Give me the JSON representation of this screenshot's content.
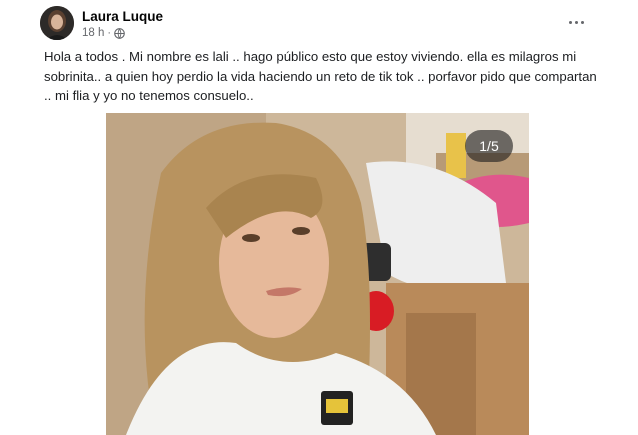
{
  "post": {
    "author": "Laura Luque",
    "time": "18 h",
    "separator": "·",
    "privacy_icon": "globe-icon",
    "more_icon": "more-options-icon",
    "text": "Hola a todos . Mi nombre es lali .. hago público  esto que estoy viviendo.  ella es milagros mi sobrinita.. a quien hoy perdio la vida haciendo un reto de tik tok .. porfavor pido que compartan .. mi flia y yo no tenemos consuelo.."
  },
  "photo": {
    "counter": "1/5"
  },
  "colors": {
    "text": "#1c1e21",
    "secondary": "#65676b",
    "badge_bg": "#3a3a3a"
  }
}
